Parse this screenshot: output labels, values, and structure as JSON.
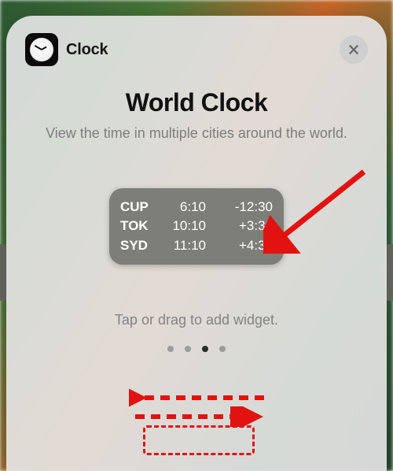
{
  "app": {
    "name": "Clock"
  },
  "title": "World Clock",
  "subtitle": "View the time in multiple cities around the world.",
  "widget": {
    "rows": [
      {
        "city": "CUP",
        "time": "6:10",
        "offset": "-12:30"
      },
      {
        "city": "TOK",
        "time": "10:10",
        "offset": "+3:30"
      },
      {
        "city": "SYD",
        "time": "11:10",
        "offset": "+4:30"
      }
    ]
  },
  "hint": "Tap or drag to add widget.",
  "pager": {
    "count": 4,
    "active_index": 2
  },
  "colors": {
    "annotation": "#e1120f",
    "widget_bg": "#7d7e78"
  }
}
